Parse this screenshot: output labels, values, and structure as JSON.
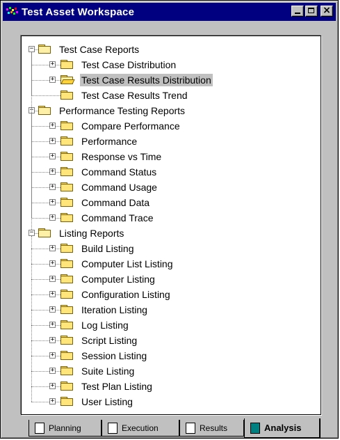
{
  "window": {
    "title": "Test Asset Workspace",
    "controls": {
      "minimize": "_",
      "maximize": "□",
      "close": "×"
    }
  },
  "tree": {
    "groups": [
      {
        "label": "Test Case Reports",
        "expander": "−",
        "children": [
          {
            "label": "Test Case Distribution",
            "expander": "+"
          },
          {
            "label": "Test Case Results Distribution",
            "expander": "+",
            "selected": true,
            "open": true
          },
          {
            "label": "Test Case Results Trend",
            "expander": ""
          }
        ]
      },
      {
        "label": "Performance Testing Reports",
        "expander": "−",
        "children": [
          {
            "label": "Compare Performance",
            "expander": "+"
          },
          {
            "label": "Performance",
            "expander": "+"
          },
          {
            "label": "Response vs Time",
            "expander": "+"
          },
          {
            "label": "Command Status",
            "expander": "+"
          },
          {
            "label": "Command Usage",
            "expander": "+"
          },
          {
            "label": "Command Data",
            "expander": "+"
          },
          {
            "label": "Command Trace",
            "expander": "+"
          }
        ]
      },
      {
        "label": "Listing Reports",
        "expander": "−",
        "children": [
          {
            "label": "Build Listing",
            "expander": "+"
          },
          {
            "label": "Computer List Listing",
            "expander": "+"
          },
          {
            "label": "Computer Listing",
            "expander": "+"
          },
          {
            "label": "Configuration Listing",
            "expander": "+"
          },
          {
            "label": "Iteration Listing",
            "expander": "+"
          },
          {
            "label": "Log Listing",
            "expander": "+"
          },
          {
            "label": "Script Listing",
            "expander": "+"
          },
          {
            "label": "Session Listing",
            "expander": "+"
          },
          {
            "label": "Suite Listing",
            "expander": "+"
          },
          {
            "label": "Test Plan Listing",
            "expander": "+"
          },
          {
            "label": "User Listing",
            "expander": "+"
          }
        ]
      }
    ]
  },
  "tabs": [
    {
      "label": "Planning",
      "icon": "planning-icon",
      "active": false
    },
    {
      "label": "Execution",
      "icon": "execution-icon",
      "active": false
    },
    {
      "label": "Results",
      "icon": "results-icon",
      "active": false
    },
    {
      "label": "Analysis",
      "icon": "analysis-icon",
      "active": true
    }
  ],
  "colors": {
    "titlebar": "#000080",
    "face": "#c0c0c0",
    "folder": "#ffe57a",
    "selection": "#c0c0c0"
  }
}
